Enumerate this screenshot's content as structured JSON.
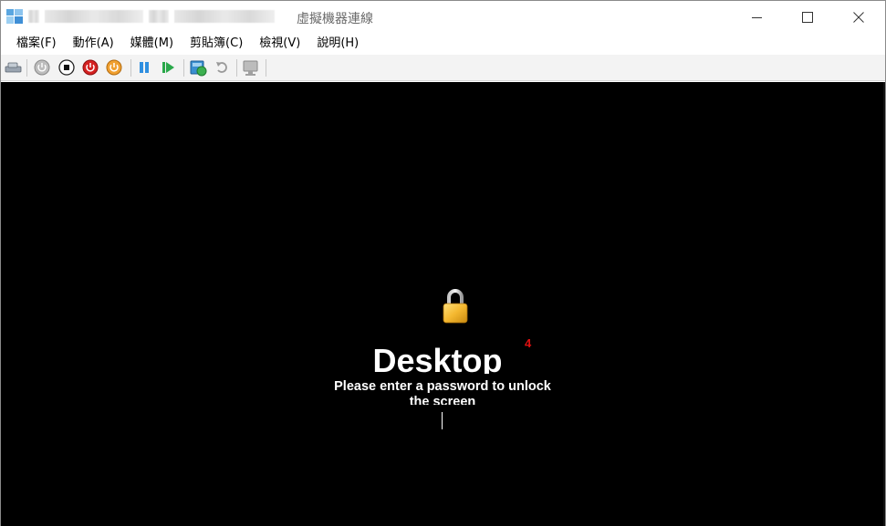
{
  "window": {
    "title": "虛擬機器連線",
    "controls": {
      "minimize_icon": "minimize-icon",
      "maximize_icon": "maximize-icon",
      "close_icon": "close-icon"
    }
  },
  "menu": {
    "items": [
      {
        "label": "檔案(F)"
      },
      {
        "label": "動作(A)"
      },
      {
        "label": "媒體(M)"
      },
      {
        "label": "剪貼簿(C)"
      },
      {
        "label": "檢視(V)"
      },
      {
        "label": "說明(H)"
      }
    ]
  },
  "toolbar": {
    "buttons": [
      {
        "icon": "ctrl-alt-del-icon"
      },
      {
        "icon": "start-icon"
      },
      {
        "icon": "turn-off-icon"
      },
      {
        "icon": "shut-down-icon"
      },
      {
        "icon": "power-icon"
      },
      {
        "icon": "pause-icon"
      },
      {
        "icon": "resume-icon"
      },
      {
        "icon": "checkpoint-icon"
      },
      {
        "icon": "revert-icon"
      },
      {
        "icon": "enhanced-session-icon"
      }
    ]
  },
  "vm_screen": {
    "badge": "4",
    "title": "Desktop",
    "message": "Please enter a password to unlock the screen"
  },
  "colors": {
    "screen_bg": "#000000",
    "badge_red": "#e01010",
    "toolbar_bg": "#f3f3f3"
  }
}
